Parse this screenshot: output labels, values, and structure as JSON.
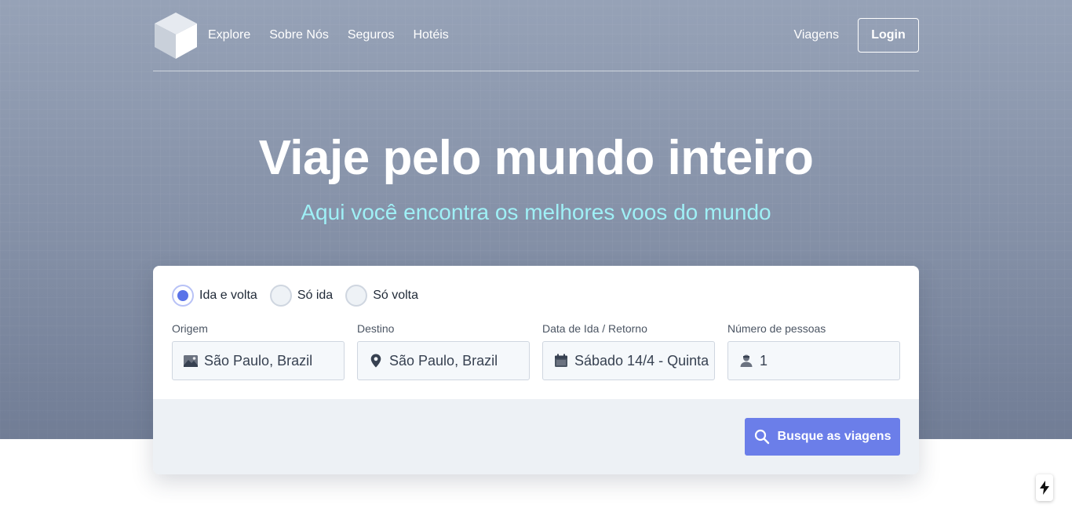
{
  "nav": {
    "links": [
      "Explore",
      "Sobre Nós",
      "Seguros",
      "Hotéis"
    ],
    "viagens": "Viagens",
    "login": "Login"
  },
  "hero": {
    "title": "Viaje pelo mundo inteiro",
    "subtitle": "Aqui você encontra os melhores voos do mundo"
  },
  "search": {
    "trip_types": [
      {
        "label": "Ida e volta",
        "selected": true
      },
      {
        "label": "Só ida",
        "selected": false
      },
      {
        "label": "Só volta",
        "selected": false
      }
    ],
    "fields": [
      {
        "label": "Origem",
        "value": "São Paulo, Brazil",
        "icon": "image-icon"
      },
      {
        "label": "Destino",
        "value": "São Paulo, Brazil",
        "icon": "map-pin-icon"
      },
      {
        "label": "Data de Ida / Retorno",
        "value": "Sábado 14/4 - Quinta",
        "icon": "calendar-icon"
      },
      {
        "label": "Número de pessoas",
        "value": "1",
        "icon": "person-icon"
      }
    ],
    "button": "Busque as viagens"
  },
  "colors": {
    "accent": "#6b7ee9",
    "subtitle": "#9ff0f6",
    "radio_selected": "#5a73e8"
  }
}
